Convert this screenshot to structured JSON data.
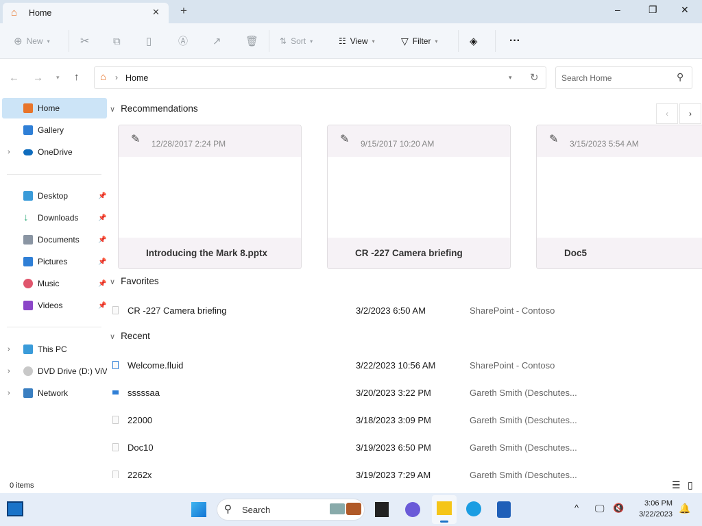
{
  "window": {
    "tab_title": "Home",
    "new_tab": "+",
    "minimize": "–",
    "restore": "❐",
    "close": "✕"
  },
  "toolbar": {
    "new": "New",
    "sort": "Sort",
    "view": "View",
    "filter": "Filter",
    "more": "···"
  },
  "address": {
    "path": "Home",
    "search_placeholder": "Search Home"
  },
  "sidebar": {
    "items": [
      {
        "label": "Home",
        "color": "#e8742a"
      },
      {
        "label": "Gallery",
        "color": "#2f7fd6"
      },
      {
        "label": "OneDrive",
        "color": "#0f6cbd"
      },
      {
        "label": "Desktop",
        "color": "#3a9bd9"
      },
      {
        "label": "Downloads",
        "color": "#2aa876"
      },
      {
        "label": "Documents",
        "color": "#8a95a3"
      },
      {
        "label": "Pictures",
        "color": "#2f7fd6"
      },
      {
        "label": "Music",
        "color": "#e0566d"
      },
      {
        "label": "Videos",
        "color": "#8b46c8"
      },
      {
        "label": "This PC",
        "color": "#3a9bd9"
      },
      {
        "label": "DVD Drive (D:) ViVe",
        "color": "#b8b8b8"
      },
      {
        "label": "Network",
        "color": "#3a7fc1"
      }
    ]
  },
  "sections": {
    "recommendations": "Recommendations",
    "favorites": "Favorites",
    "recent": "Recent"
  },
  "recommendations": [
    {
      "date": "12/28/2017 2:24 PM",
      "name": "Introducing the Mark 8.pptx"
    },
    {
      "date": "9/15/2017 10:20 AM",
      "name": "CR -227 Camera briefing"
    },
    {
      "date": "3/15/2023 5:54 AM",
      "name": "Doc5"
    }
  ],
  "favorites": [
    {
      "name": "CR -227 Camera briefing",
      "date": "3/2/2023 6:50 AM",
      "location": "SharePoint - Contoso"
    }
  ],
  "recent": [
    {
      "name": "Welcome.fluid",
      "date": "3/22/2023 10:56 AM",
      "location": "SharePoint - Contoso"
    },
    {
      "name": "sssssaa",
      "date": "3/20/2023 3:22 PM",
      "location": "Gareth Smith (Deschutes..."
    },
    {
      "name": "22000",
      "date": "3/18/2023 3:09 PM",
      "location": "Gareth Smith (Deschutes..."
    },
    {
      "name": "Doc10",
      "date": "3/19/2023 6:50 PM",
      "location": "Gareth Smith (Deschutes..."
    },
    {
      "name": "2262x",
      "date": "3/19/2023 7:29 AM",
      "location": "Gareth Smith (Deschutes..."
    }
  ],
  "status": {
    "items": "0 items"
  },
  "taskbar": {
    "search": "Search",
    "time": "3:06 PM",
    "date": "3/22/2023"
  }
}
